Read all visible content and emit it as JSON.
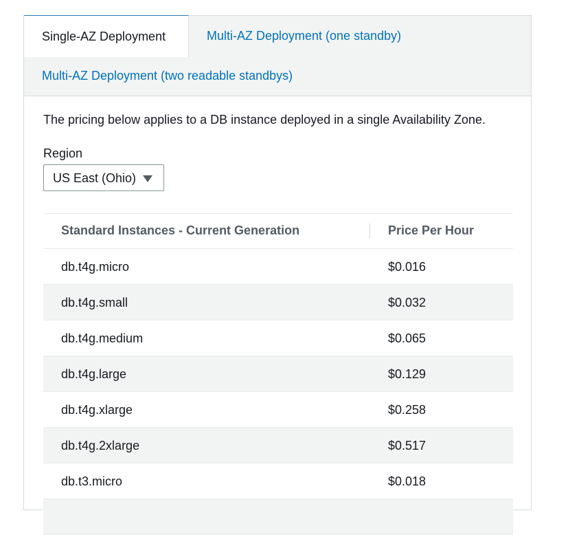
{
  "tabs": {
    "single_az": "Single-AZ Deployment",
    "multi_az_one": "Multi-AZ Deployment (one standby)",
    "multi_az_two": "Multi-AZ Deployment (two readable standbys)",
    "active": "single_az"
  },
  "description": "The pricing below applies to a DB instance deployed in a single Availability Zone.",
  "region": {
    "label": "Region",
    "selected": "US East (Ohio)"
  },
  "table": {
    "columns": [
      "Standard Instances - Current Generation",
      "Price Per Hour"
    ],
    "rows": [
      {
        "name": "db.t4g.micro",
        "price": "$0.016"
      },
      {
        "name": "db.t4g.small",
        "price": "$0.032"
      },
      {
        "name": "db.t4g.medium",
        "price": "$0.065"
      },
      {
        "name": "db.t4g.large",
        "price": "$0.129"
      },
      {
        "name": "db.t4g.xlarge",
        "price": "$0.258"
      },
      {
        "name": "db.t4g.2xlarge",
        "price": "$0.517"
      },
      {
        "name": "db.t3.micro",
        "price": "$0.018"
      },
      {
        "name": "",
        "price": ""
      }
    ]
  },
  "colors": {
    "link": "#0073bb",
    "text": "#16191f",
    "stripe": "#f2f3f3"
  }
}
